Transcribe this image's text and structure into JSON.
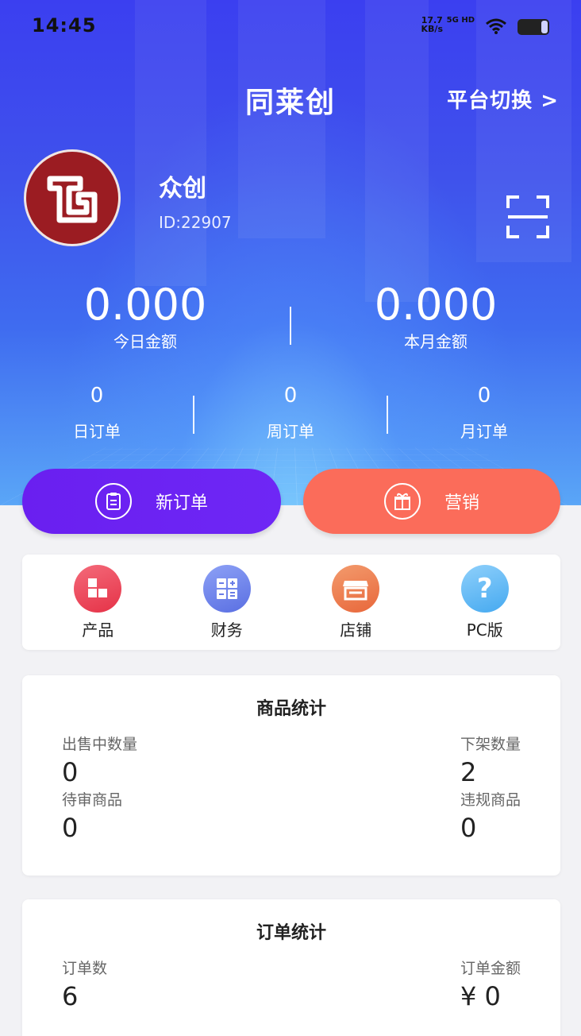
{
  "status_bar": {
    "time": "14:45",
    "speed_value": "17.7",
    "speed_unit": "KB/s",
    "network": "5G HD"
  },
  "header": {
    "title": "同莱创",
    "switch_label": "平台切换 >"
  },
  "profile": {
    "name": "众创",
    "id": "ID:22907"
  },
  "amounts": {
    "today_value": "0.000",
    "today_label": "今日金额",
    "month_value": "0.000",
    "month_label": "本月金额"
  },
  "orders": {
    "day_value": "0",
    "day_label": "日订单",
    "week_value": "0",
    "week_label": "周订单",
    "month_value": "0",
    "month_label": "月订单"
  },
  "actions": {
    "new_order_label": "新订单",
    "marketing_label": "营销"
  },
  "quick_menu": [
    {
      "label": "产品",
      "icon": "grid-blocks-icon",
      "color": "#e53247"
    },
    {
      "label": "财务",
      "icon": "calculator-icon",
      "color": "#5a6fe2"
    },
    {
      "label": "店铺",
      "icon": "store-icon",
      "color": "#e8673b"
    },
    {
      "label": "PC版",
      "icon": "question-icon",
      "color": "#45a9f0"
    }
  ],
  "goods_stats": {
    "title": "商品统计",
    "on_sale_label": "出售中数量",
    "on_sale_value": "0",
    "off_shelf_label": "下架数量",
    "off_shelf_value": "2",
    "pending_label": "待审商品",
    "pending_value": "0",
    "violation_label": "违规商品",
    "violation_value": "0"
  },
  "order_stats": {
    "title": "订单统计",
    "count_label": "订单数",
    "count_value": "6",
    "amount_label": "订单金额",
    "amount_value": "¥ 0"
  },
  "colors": {
    "hero_top": "#3b3ff0",
    "new_order_button": "#6a1ff0",
    "marketing_button": "#fb6c5a",
    "avatar_bg": "#9b1c22"
  }
}
